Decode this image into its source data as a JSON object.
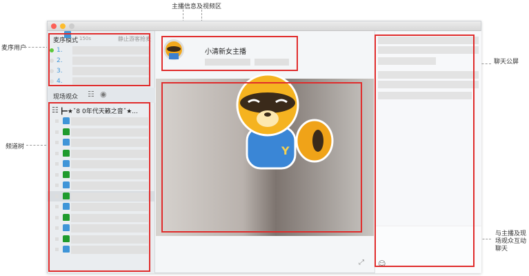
{
  "annotations": {
    "anchor_video": "主播信息及视频区",
    "mic_users": "麦序用户",
    "channel_tree": "频道树",
    "public_chat": "聊天公屏",
    "interactive_chat": "与主播及现场观众互动聊天"
  },
  "mic_queue": {
    "mode_label": "麦序模式",
    "timer": "150s",
    "action": "静止游客抢麦",
    "items": [
      "1.",
      "2.",
      "3.",
      "4."
    ]
  },
  "audience": {
    "label": "现场观众",
    "channel_name": "┣━★ˇ8 0年代天籁之音ˇ★..."
  },
  "anchor": {
    "name": "小清新女主播"
  },
  "colors": {
    "annotation_box": "#e02b2b",
    "online": "#5cc83a",
    "member_blue": "#3f95d8",
    "member_green": "#1f9b2d"
  }
}
